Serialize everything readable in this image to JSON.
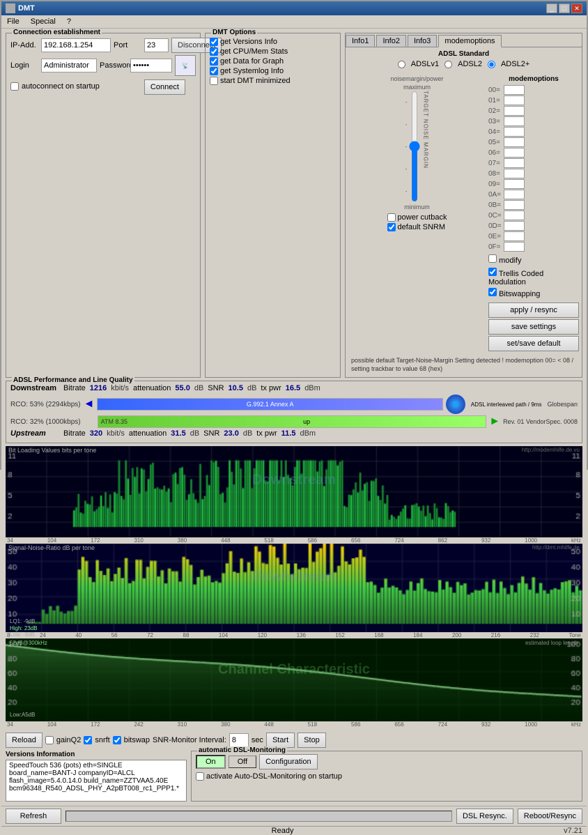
{
  "window": {
    "title": "DMT"
  },
  "menu": {
    "items": [
      "File",
      "Special",
      "?"
    ]
  },
  "connection": {
    "title": "Connection establishment",
    "ip_label": "IP-Add.",
    "ip_value": "192.168.1.254",
    "port_label": "Port",
    "port_value": "23",
    "login_label": "Login",
    "login_value": "Administrator",
    "password_label": "Password",
    "password_value": "••••••",
    "disconnect_btn": "Disconnect",
    "connect_btn": "Connect",
    "autoconnect_label": "autoconnect on startup"
  },
  "dmt_options": {
    "title": "DMT Options",
    "options": [
      "get Versions Info",
      "get CPU/Mem Stats",
      "get Data for Graph",
      "get Systemlog Info",
      "start DMT minimized"
    ]
  },
  "tabs": {
    "items": [
      "Info1",
      "Info2",
      "Info3",
      "modemoptions"
    ],
    "active": "modemoptions"
  },
  "adsl_standard": {
    "label": "ADSL Standard",
    "options": [
      "ADSLv1",
      "ADSL2",
      "ADSL2+"
    ],
    "selected": "ADSL2+"
  },
  "modem_options": {
    "title": "modemoptions",
    "rows": [
      {
        "key": "00=",
        "val": ""
      },
      {
        "key": "01=",
        "val": ""
      },
      {
        "key": "02=",
        "val": ""
      },
      {
        "key": "03=",
        "val": ""
      },
      {
        "key": "04=",
        "val": ""
      },
      {
        "key": "05=",
        "val": ""
      },
      {
        "key": "06=",
        "val": ""
      },
      {
        "key": "07=",
        "val": ""
      },
      {
        "key": "08=",
        "val": ""
      },
      {
        "key": "09=",
        "val": ""
      },
      {
        "key": "0A=",
        "val": ""
      },
      {
        "key": "0B=",
        "val": ""
      },
      {
        "key": "0C=",
        "val": ""
      },
      {
        "key": "0D=",
        "val": ""
      },
      {
        "key": "0E=",
        "val": ""
      },
      {
        "key": "0F=",
        "val": ""
      }
    ]
  },
  "slider_labels": {
    "target_noise_margin": "T A R G E T   N O I S E   M A R G I N",
    "maximum": "maximum",
    "minimum": "minimum"
  },
  "modify_checkbox": "modify",
  "checkboxes": {
    "trellis": "Trellis Coded Modulation",
    "bitswapping": "Bitswapping"
  },
  "buttons": {
    "apply_resync": "apply / resync",
    "save_settings": "save settings",
    "set_save_default": "set/save default"
  },
  "adsl_performance": {
    "title": "ADSL Performance and Line Quality",
    "downstream": {
      "label": "Downstream",
      "bitrate_label": "Bitrate",
      "bitrate_value": "1216",
      "bitrate_unit": "kbit/s",
      "attenuation_label": "attenuation",
      "attenuation_value": "55.0",
      "attenuation_unit": "dB",
      "snr_label": "SNR",
      "snr_value": "10.5",
      "snr_unit": "dB",
      "txpwr_label": "tx pwr",
      "txpwr_value": "16.5",
      "txpwr_unit": "dBm"
    },
    "upstream": {
      "label": "Upstream",
      "bitrate_label": "Bitrate",
      "bitrate_value": "320",
      "bitrate_unit": "kbit/s",
      "attenuation_label": "attenuation",
      "attenuation_value": "31.5",
      "attenuation_unit": "dB",
      "snr_label": "SNR",
      "snr_value": "23.0",
      "snr_unit": "dB",
      "txpwr_label": "tx pwr",
      "txpwr_value": "11.5",
      "txpwr_unit": "dBm"
    },
    "rco_dl": "RCO: 53% (2294kbps)",
    "rco_ul": "RCO: 32% (1000kbps)",
    "annex": "G.992.1 Annex A",
    "path": "ADSL interleaved path / 9ms",
    "vendor": "Globespan",
    "rev": "Rev. 01",
    "vendorspec": "VendorSpec. 0008"
  },
  "graphs": {
    "bitloading": {
      "title": "Bit Loading Values  bits per tone",
      "url": "http://modemhilfe.de.vu",
      "watermark": "Downstream",
      "x_labels": [
        "34",
        "104",
        "172",
        "310",
        "380",
        "448",
        "518",
        "586",
        "656",
        "724",
        "862",
        "932",
        "1000",
        "kHz"
      ],
      "y_right": [
        "11",
        "8",
        "5",
        "2"
      ],
      "y_left": [
        "11",
        "8",
        "5",
        "2"
      ]
    },
    "snr": {
      "title": "Signal-Noise-Ratio  dB per tone",
      "url": "http://dmt.mhilfe.de",
      "watermark": "Downstream",
      "lq1": "LQ1: -9dB",
      "high": "High: 23dB",
      "low": "Low: -9dB",
      "x_labels": [
        "8",
        "24",
        "40",
        "56",
        "72",
        "88",
        "104",
        "120",
        "136",
        "152",
        "168",
        "184",
        "200",
        "216",
        "232",
        "Tone"
      ]
    },
    "channel": {
      "watermark": "Channel Characteristic",
      "label": "52dB@300kHz",
      "estimated": "estimated loop length",
      "low_label": "Low:A5dB",
      "x_labels": [
        "34",
        "104",
        "172",
        "242",
        "310",
        "380",
        "448",
        "518",
        "586",
        "656",
        "724",
        "932",
        "1000",
        "kHz"
      ]
    }
  },
  "controls": {
    "reload_btn": "Reload",
    "gainQ2_label": "gainQ2",
    "snrft_label": "snrft",
    "bitswap_label": "bitswap",
    "snr_monitor_label": "SNR-Monitor Interval:",
    "snr_monitor_value": "8",
    "snr_monitor_unit": "sec",
    "start_btn": "Start",
    "stop_btn": "Stop"
  },
  "versions": {
    "title": "Versions Information",
    "lines": [
      "SpeedTouch 536 (pots) eth=SINGLE",
      "board_name=BANT-J  companyID=ALCL",
      "flash_image=5.4.0.14.0  build_name=ZZTVAA5.40E",
      "bcm96348_R540_ADSL_PHY_A2pBT008_rc1_PPP1.*"
    ]
  },
  "auto_dsl": {
    "title": "automatic DSL-Monitoring",
    "on_btn": "On",
    "off_btn": "Off",
    "config_btn": "Configuration",
    "activate_label": "activate Auto-DSL-Monitoring on startup"
  },
  "possible_notice": "possible default Target-Noise-Margin Setting detected ! modemoption 00= < 08 / setting trackbar to value 68 (hex)",
  "power_cutback_label": "power cutback",
  "default_snrm_label": "default SNRM",
  "bottom_bar": {
    "refresh_btn": "Refresh",
    "dsl_resync_btn": "DSL Resync.",
    "reboot_resync_btn": "Reboot/Resync"
  },
  "status": {
    "text": "Ready",
    "version": "v7.21"
  }
}
